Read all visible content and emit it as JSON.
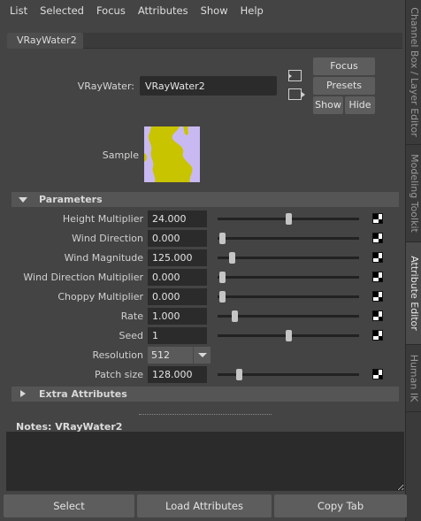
{
  "menu": [
    "List",
    "Selected",
    "Focus",
    "Attributes",
    "Show",
    "Help"
  ],
  "side_tabs": [
    {
      "label": "Channel Box / Layer Editor",
      "active": false
    },
    {
      "label": "Modeling Toolkit",
      "active": false
    },
    {
      "label": "Attribute Editor",
      "active": true
    },
    {
      "label": "Human IK",
      "active": false
    }
  ],
  "node_tab": "VRayWater2",
  "node": {
    "type_label": "VRayWater:",
    "name": "VRayWater2"
  },
  "buttons": {
    "focus": "Focus",
    "presets": "Presets",
    "show": "Show",
    "hide": "Hide"
  },
  "sample_label": "Sample",
  "sections": {
    "parameters": "Parameters",
    "extra": "Extra Attributes"
  },
  "params": [
    {
      "label": "Height Multiplier",
      "value": "24.000",
      "slider": 0.5
    },
    {
      "label": "Wind Direction",
      "value": "0.000",
      "slider": 0.03
    },
    {
      "label": "Wind Magnitude",
      "value": "125.000",
      "slider": 0.1
    },
    {
      "label": "Wind Direction Multiplier",
      "value": "0.000",
      "slider": 0.03
    },
    {
      "label": "Choppy Multiplier",
      "value": "0.000",
      "slider": 0.03
    },
    {
      "label": "Rate",
      "value": "1.000",
      "slider": 0.12
    },
    {
      "label": "Seed",
      "value": "1",
      "slider": 0.5
    },
    {
      "label": "Resolution",
      "value": "512",
      "dropdown": true
    },
    {
      "label": "Patch size",
      "value": "128.000",
      "slider": 0.15
    }
  ],
  "notes": {
    "label": "Notes:  VRayWater2",
    "text": ""
  },
  "bottom_buttons": [
    "Select",
    "Load Attributes",
    "Copy Tab"
  ],
  "colors": {
    "panel": "#444444",
    "field": "#2b2b2b",
    "button": "#5d5d5d",
    "sample_bg": "#c9b9f2",
    "sample_fg": "#c8c400"
  }
}
